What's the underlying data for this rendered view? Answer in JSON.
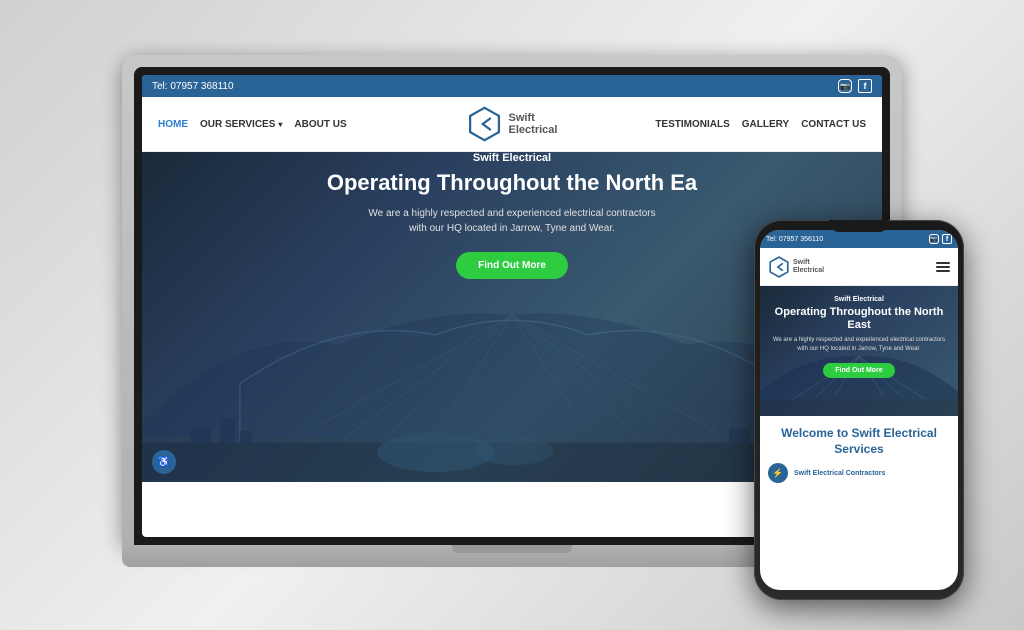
{
  "scene": {
    "bg_color": "#d5d5d5"
  },
  "topbar": {
    "phone": "Tel: 07957 368110",
    "instagram_label": "i",
    "facebook_label": "f"
  },
  "header": {
    "logo_name": "Swift",
    "logo_subtitle": "Electrical",
    "nav_left": [
      {
        "label": "HOME",
        "active": true
      },
      {
        "label": "OUR SERVICES",
        "hasDropdown": true
      },
      {
        "label": "ABOUT US",
        "hasDropdown": false
      }
    ],
    "nav_right": [
      {
        "label": "TESTIMONIALS"
      },
      {
        "label": "GALLERY"
      },
      {
        "label": "CONTACT US"
      }
    ]
  },
  "hero": {
    "subtitle": "Swift Electrical",
    "title": "Operating Throughout the North Ea",
    "description": "We are a highly respected and experienced electrical contractors\nwith our HQ located in Jarrow, Tyne and Wear.",
    "cta_label": "Find Out More"
  },
  "phone": {
    "topbar_phone": "Tel: 07957 356110",
    "hero_subtitle": "Swift Electrical",
    "hero_title": "Operating Throughout the North East",
    "hero_desc": "We are a highly respected and experienced electrical contractors with our HQ located in Jarrow, Tyne and Wear.",
    "hero_cta": "Find Out More",
    "welcome_title": "Welcome to Swift Electrical Services",
    "welcome_sub": "Swift Electrical Contractors"
  }
}
